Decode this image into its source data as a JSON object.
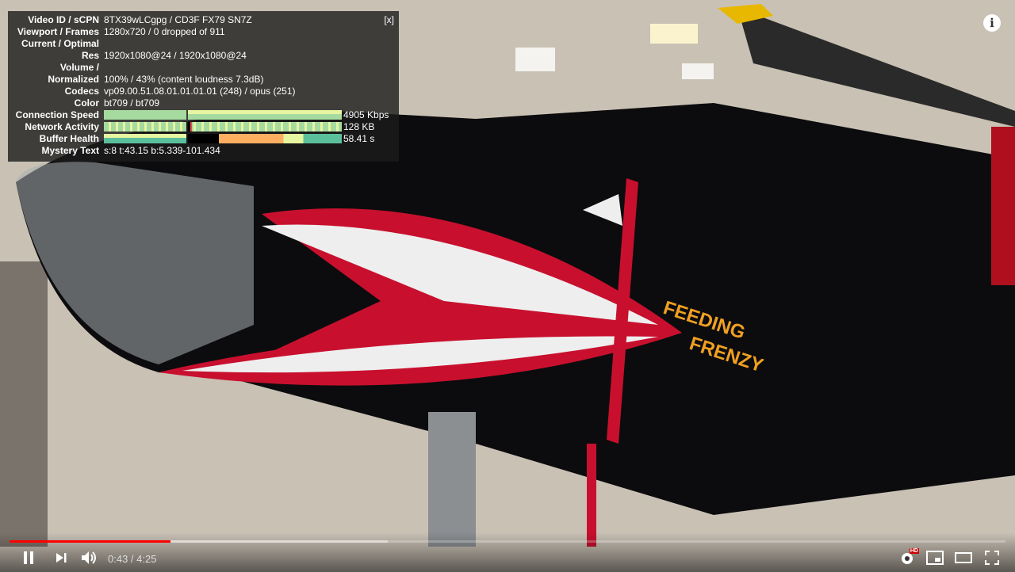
{
  "stats": {
    "close_label": "[x]",
    "rows": [
      {
        "label": "Video ID / sCPN",
        "value": "8TX39wLCgpg / CD3F FX79 SN7Z"
      },
      {
        "label": "Viewport / Frames",
        "value": "1280x720 / 0 dropped of 911"
      },
      {
        "label": "Current / Optimal",
        "value": ""
      },
      {
        "label": "Res",
        "value": "1920x1080@24 / 1920x1080@24"
      },
      {
        "label": "Volume /",
        "value": ""
      },
      {
        "label": "Normalized",
        "value": "100% / 43% (content loudness 7.3dB)"
      },
      {
        "label": "Codecs",
        "value": "vp09.00.51.08.01.01.01.01 (248) / opus (251)"
      },
      {
        "label": "Color",
        "value": "bt709 / bt709"
      }
    ],
    "graphs": [
      {
        "label": "Connection Speed",
        "value": "4905 Kbps"
      },
      {
        "label": "Network Activity",
        "value": "128 KB"
      },
      {
        "label": "Buffer Health",
        "value": "58.41 s"
      }
    ],
    "mystery": {
      "label": "Mystery Text",
      "value": "s:8 t:43.15 b:5.339-101.434"
    }
  },
  "info_label": "i",
  "aircraft_text": [
    "FEEDING",
    "FRENZY"
  ],
  "player": {
    "current_time": "0:43",
    "separator": " / ",
    "duration": "4:25",
    "played_fraction": 0.162,
    "buffered_fraction": 0.38,
    "hd_badge": "HD",
    "colors": {
      "progress": "#ff0000",
      "hd": "#cc0000"
    }
  }
}
